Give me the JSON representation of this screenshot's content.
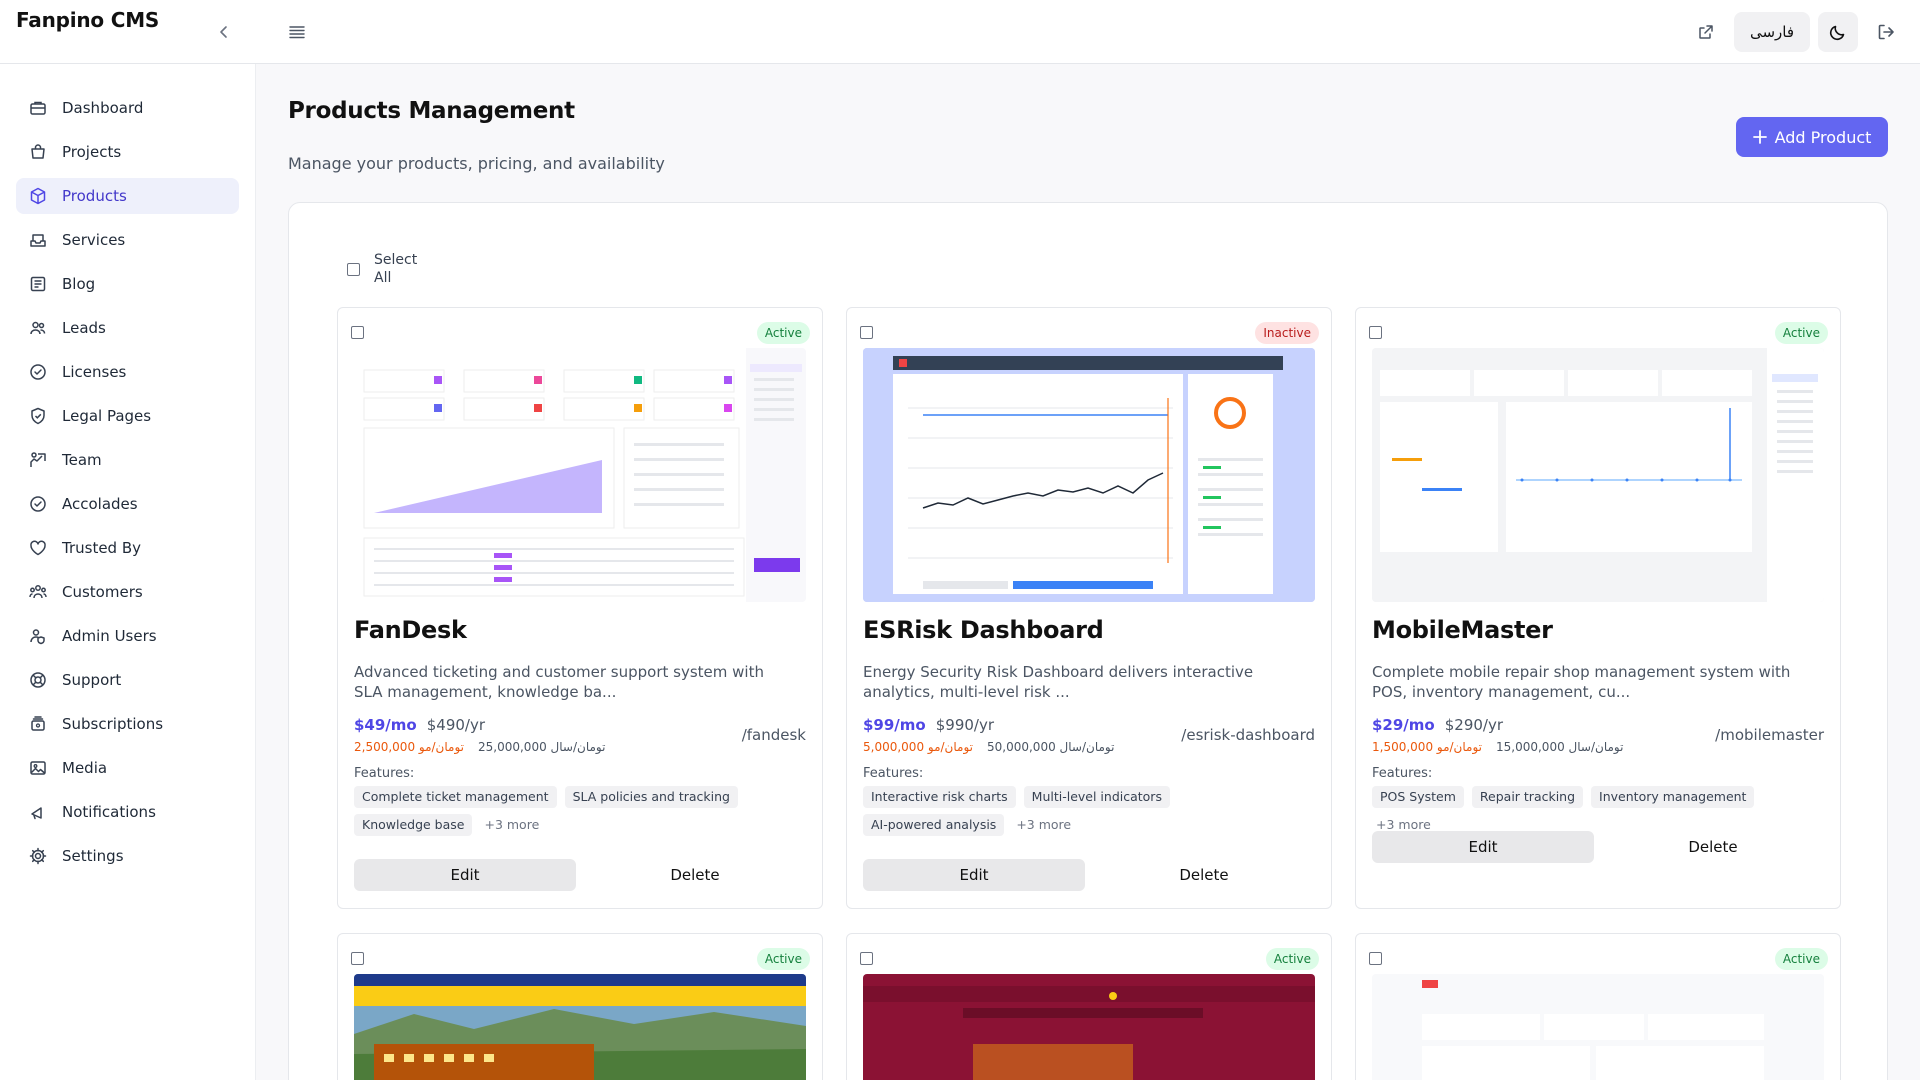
{
  "app": {
    "title": "Fanpino CMS"
  },
  "topbar": {
    "language_label": "فارسی"
  },
  "sidebar": {
    "items": [
      {
        "label": "Dashboard"
      },
      {
        "label": "Projects"
      },
      {
        "label": "Products"
      },
      {
        "label": "Services"
      },
      {
        "label": "Blog"
      },
      {
        "label": "Leads"
      },
      {
        "label": "Licenses"
      },
      {
        "label": "Legal Pages"
      },
      {
        "label": "Team"
      },
      {
        "label": "Accolades"
      },
      {
        "label": "Trusted By"
      },
      {
        "label": "Customers"
      },
      {
        "label": "Admin Users"
      },
      {
        "label": "Support"
      },
      {
        "label": "Subscriptions"
      },
      {
        "label": "Media"
      },
      {
        "label": "Notifications"
      },
      {
        "label": "Settings"
      }
    ]
  },
  "page": {
    "title": "Products Management",
    "subtitle": "Manage your products, pricing, and availability",
    "add_button": "Add Product",
    "select_all": "Select All"
  },
  "products": [
    {
      "name": "FanDesk",
      "status": "Active",
      "description": "Advanced ticketing and customer support system with SLA management, knowledge ba...",
      "price_monthly": "$49/mo",
      "price_yearly": "$490/yr",
      "toman_monthly": "2,500,000 تومان/مو",
      "toman_yearly": "25,000,000 تومان/سال",
      "slug": "/fandesk",
      "features_label": "Features:",
      "features": [
        "Complete ticket management",
        "SLA policies and tracking",
        "Knowledge base"
      ],
      "more": "+3 more",
      "edit": "Edit",
      "delete": "Delete"
    },
    {
      "name": "ESRisk Dashboard",
      "status": "Inactive",
      "description": "Energy Security Risk Dashboard delivers interactive analytics, multi-level risk ...",
      "price_monthly": "$99/mo",
      "price_yearly": "$990/yr",
      "toman_monthly": "5,000,000 تومان/مو",
      "toman_yearly": "50,000,000 تومان/سال",
      "slug": "/esrisk-dashboard",
      "features_label": "Features:",
      "features": [
        "Interactive risk charts",
        "Multi-level indicators",
        "AI-powered analysis"
      ],
      "more": "+3 more",
      "edit": "Edit",
      "delete": "Delete"
    },
    {
      "name": "MobileMaster",
      "status": "Active",
      "description": "Complete mobile repair shop management system with POS, inventory management, cu...",
      "price_monthly": "$29/mo",
      "price_yearly": "$290/yr",
      "toman_monthly": "1,500,000 تومان/مو",
      "toman_yearly": "15,000,000 تومان/سال",
      "slug": "/mobilemaster",
      "features_label": "Features:",
      "features": [
        "POS System",
        "Repair tracking",
        "Inventory management"
      ],
      "more": "+3 more",
      "edit": "Edit",
      "delete": "Delete"
    },
    {
      "status": "Active"
    },
    {
      "status": "Active"
    },
    {
      "status": "Active"
    }
  ]
}
